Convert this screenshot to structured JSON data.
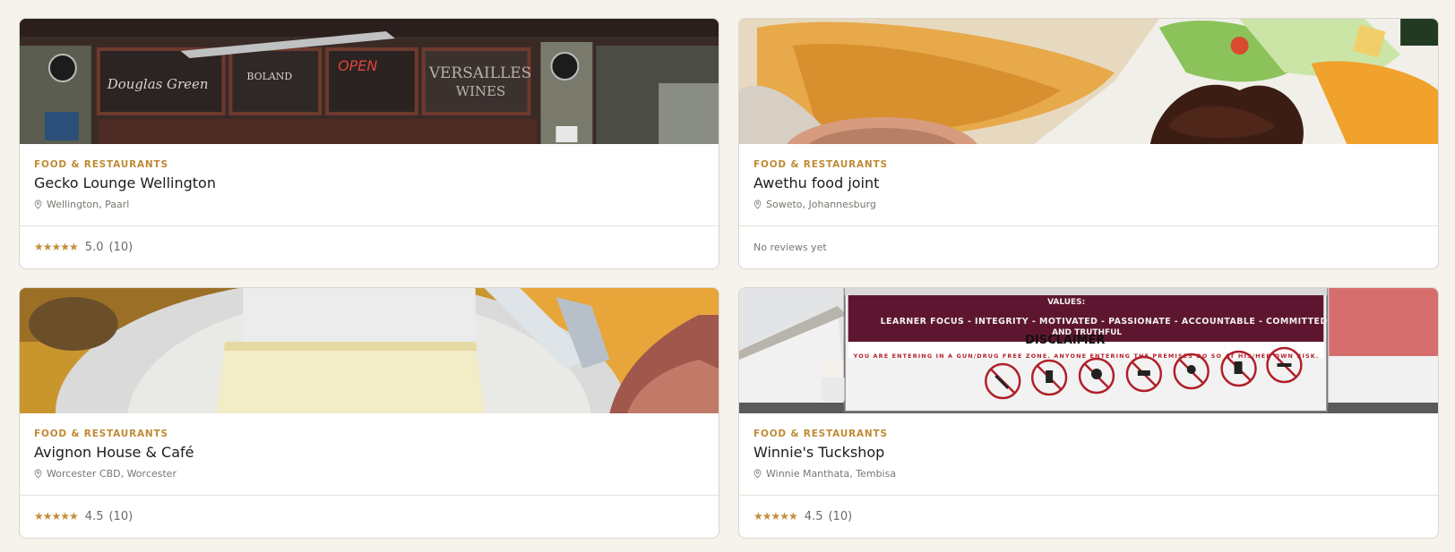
{
  "listings": [
    {
      "category": "Food & Restaurants",
      "name": "Gecko Lounge Wellington",
      "location": "Wellington, Paarl",
      "stars": "★★★★★",
      "rating": "5.0",
      "reviews": "(10)",
      "image_text": [
        "Douglas Green",
        "BOLAND",
        "OPEN",
        "VERSAILLES",
        "WINES"
      ]
    },
    {
      "category": "Food & Restaurants",
      "name": "Awethu food joint",
      "location": "Soweto, Johannesburg",
      "no_reviews": "No reviews yet"
    },
    {
      "category": "Food & Restaurants",
      "name": "Avignon House & Café",
      "location": "Worcester CBD, Worcester",
      "stars": "★★★★★",
      "rating": "4.5",
      "reviews": "(10)"
    },
    {
      "category": "Food & Restaurants",
      "name": "Winnie's Tuckshop",
      "location": "Winnie Manthata, Tembisa",
      "stars": "★★★★★",
      "rating": "4.5",
      "reviews": "(10)",
      "image_text": [
        "VALUES:",
        "LEARNER FOCUS - INTEGRITY - MOTIVATED - PASSIONATE - ACCOUNTABLE - COMMITTED",
        "AND TRUTHFUL",
        "DISCLAIMER",
        "YOU ARE ENTERING IN A GUN/DRUG FREE ZONE. ANYONE ENTERING THE PREMISES DO SO AT HIS/HER OWN RISK."
      ]
    }
  ],
  "colors": {
    "page_bg": "#f6f2ec",
    "accent": "#bf8a35",
    "card_border": "#d9d5ce"
  }
}
